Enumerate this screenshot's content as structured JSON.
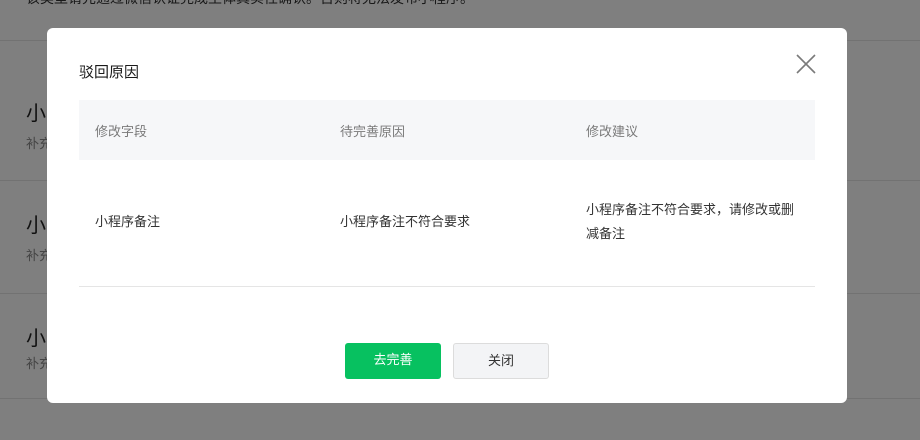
{
  "background": {
    "top_text": "该类型请先通过微信认证完成主体真实性确认。否则将无法发布小程序。",
    "items": [
      {
        "title": "小",
        "sub": "补充"
      },
      {
        "title": "小",
        "sub": "补充"
      },
      {
        "title": "小",
        "sub": "补充"
      }
    ]
  },
  "dialog": {
    "title": "驳回原因",
    "close_icon": "close-icon",
    "table": {
      "headers": [
        "修改字段",
        "待完善原因",
        "修改建议"
      ],
      "rows": [
        [
          "小程序备注",
          "小程序备注不符合要求",
          "小程序备注不符合要求，请修改或删减备注"
        ]
      ]
    },
    "buttons": {
      "primary_label": "去完善",
      "secondary_label": "关闭"
    }
  },
  "colors": {
    "primary": "#07c160",
    "mask": "rgba(0,0,0,0.5)"
  }
}
